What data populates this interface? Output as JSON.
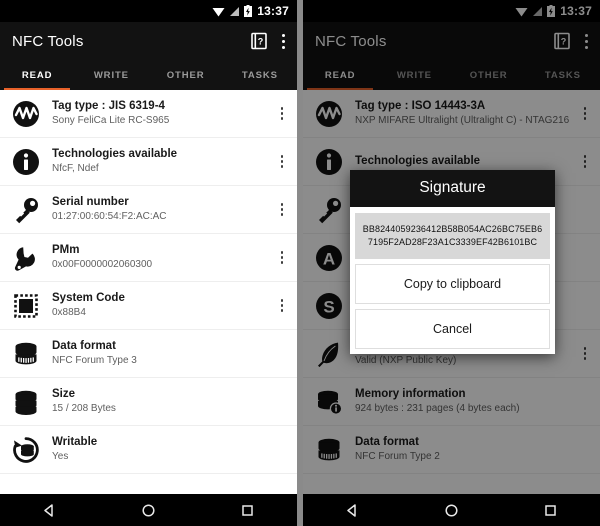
{
  "statusbar": {
    "time": "13:37",
    "icons": [
      "wifi-icon",
      "signal-icon",
      "battery-charging-icon"
    ]
  },
  "toolbar": {
    "title": "NFC Tools",
    "help_icon": "help-card-icon",
    "overflow_icon": "overflow-menu-icon"
  },
  "tabs": [
    {
      "label": "READ",
      "active": true
    },
    {
      "label": "WRITE",
      "active": false
    },
    {
      "label": "OTHER",
      "active": false
    },
    {
      "label": "TASKS",
      "active": false
    }
  ],
  "accent_color": "#e8622a",
  "navbar": {
    "back": "back-triangle-icon",
    "home": "home-circle-icon",
    "recents": "recents-square-icon"
  },
  "left_screen": {
    "rows": [
      {
        "icon": "nfc-wave-icon",
        "title": "Tag type : JIS 6319-4",
        "subtitle": "Sony FeliCa Lite RC-S965",
        "kebab": true
      },
      {
        "icon": "info-icon",
        "title": "Technologies available",
        "subtitle": "NfcF, Ndef",
        "kebab": true
      },
      {
        "icon": "key-icon",
        "title": "Serial number",
        "subtitle": "01:27:00:60:54:F2:AC:AC",
        "kebab": true
      },
      {
        "icon": "wrench-icon",
        "title": "PMm",
        "subtitle": "0x00F0000002060300",
        "kebab": true
      },
      {
        "icon": "chip-icon",
        "title": "System Code",
        "subtitle": "0x88B4",
        "kebab": true
      },
      {
        "icon": "database-format-icon",
        "title": "Data format",
        "subtitle": "NFC Forum Type 3",
        "kebab": false
      },
      {
        "icon": "database-icon",
        "title": "Size",
        "subtitle": "15 / 208 Bytes",
        "kebab": false
      },
      {
        "icon": "database-rewrite-icon",
        "title": "Writable",
        "subtitle": "Yes",
        "kebab": false
      }
    ]
  },
  "right_screen": {
    "rows": [
      {
        "icon": "nfc-wave-icon",
        "title": "Tag type : ISO 14443-3A",
        "subtitle": "NXP MIFARE Ultralight (Ultralight C) - NTAG216",
        "kebab": true
      },
      {
        "icon": "info-icon",
        "title": "Technologies available",
        "subtitle": "",
        "kebab": true
      },
      {
        "icon": "key-icon",
        "title": "",
        "subtitle": "",
        "kebab": false
      },
      {
        "icon": "letter-a-icon",
        "title": "",
        "subtitle": "",
        "kebab": false
      },
      {
        "icon": "letter-s-icon",
        "title": "",
        "subtitle": "",
        "kebab": false
      },
      {
        "icon": "feather-icon",
        "title": "Signature",
        "subtitle": "Valid (NXP Public Key)",
        "kebab": true
      },
      {
        "icon": "database-info-icon",
        "title": "Memory information",
        "subtitle": "924 bytes : 231 pages (4 bytes each)",
        "kebab": false
      },
      {
        "icon": "database-format-icon",
        "title": "Data format",
        "subtitle": "NFC Forum Type 2",
        "kebab": false
      }
    ],
    "dialog": {
      "title": "Signature",
      "hex_value": "BB8244059236412B58B054AC26BC75EB67195F2AD28F23A1C3339EF42B6101BC",
      "copy_label": "Copy to clipboard",
      "cancel_label": "Cancel"
    }
  }
}
